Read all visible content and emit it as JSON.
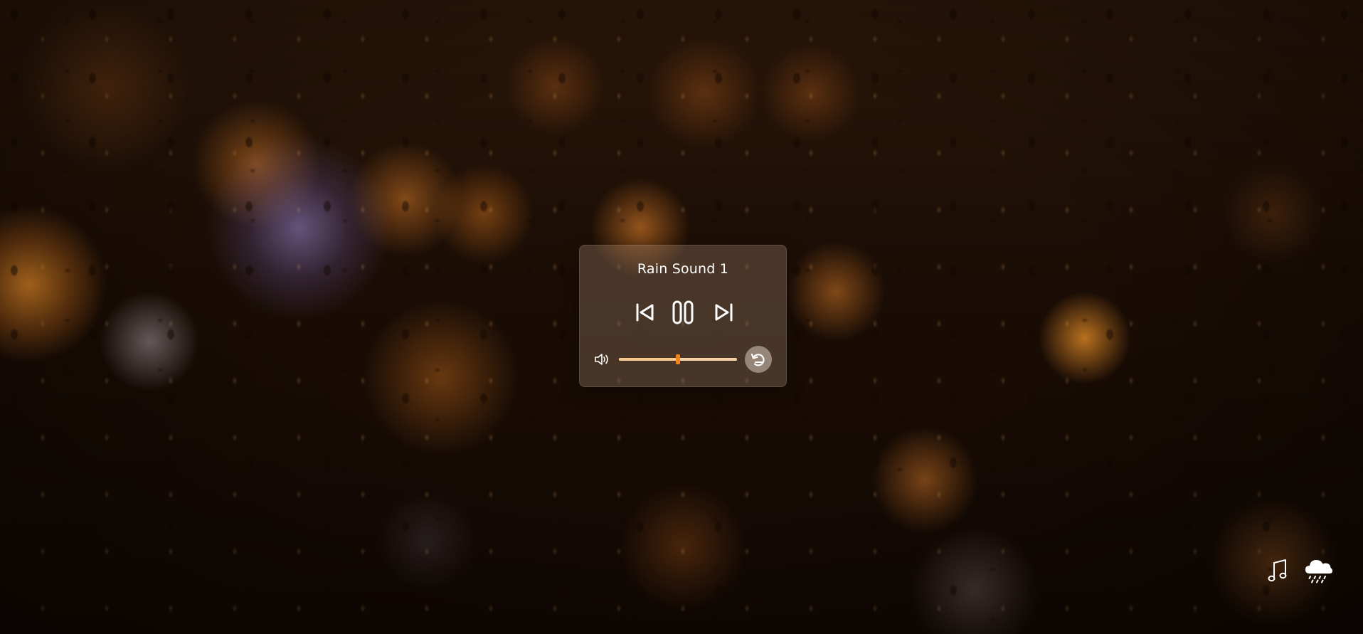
{
  "player": {
    "track_title": "Rain Sound 1",
    "is_playing": true,
    "volume": 0.5,
    "controls": {
      "previous_icon": "skip-previous-icon",
      "pause_icon": "pause-icon",
      "next_icon": "skip-next-icon",
      "volume_icon": "speaker-icon",
      "loop_icon": "loop-icon"
    }
  },
  "corner_buttons": {
    "music_icon": "music-note-icon",
    "rain_icon": "rain-cloud-icon"
  },
  "colors": {
    "accent": "#f0841b",
    "slider_track": "#f6d2a4",
    "text": "#ffffff"
  }
}
